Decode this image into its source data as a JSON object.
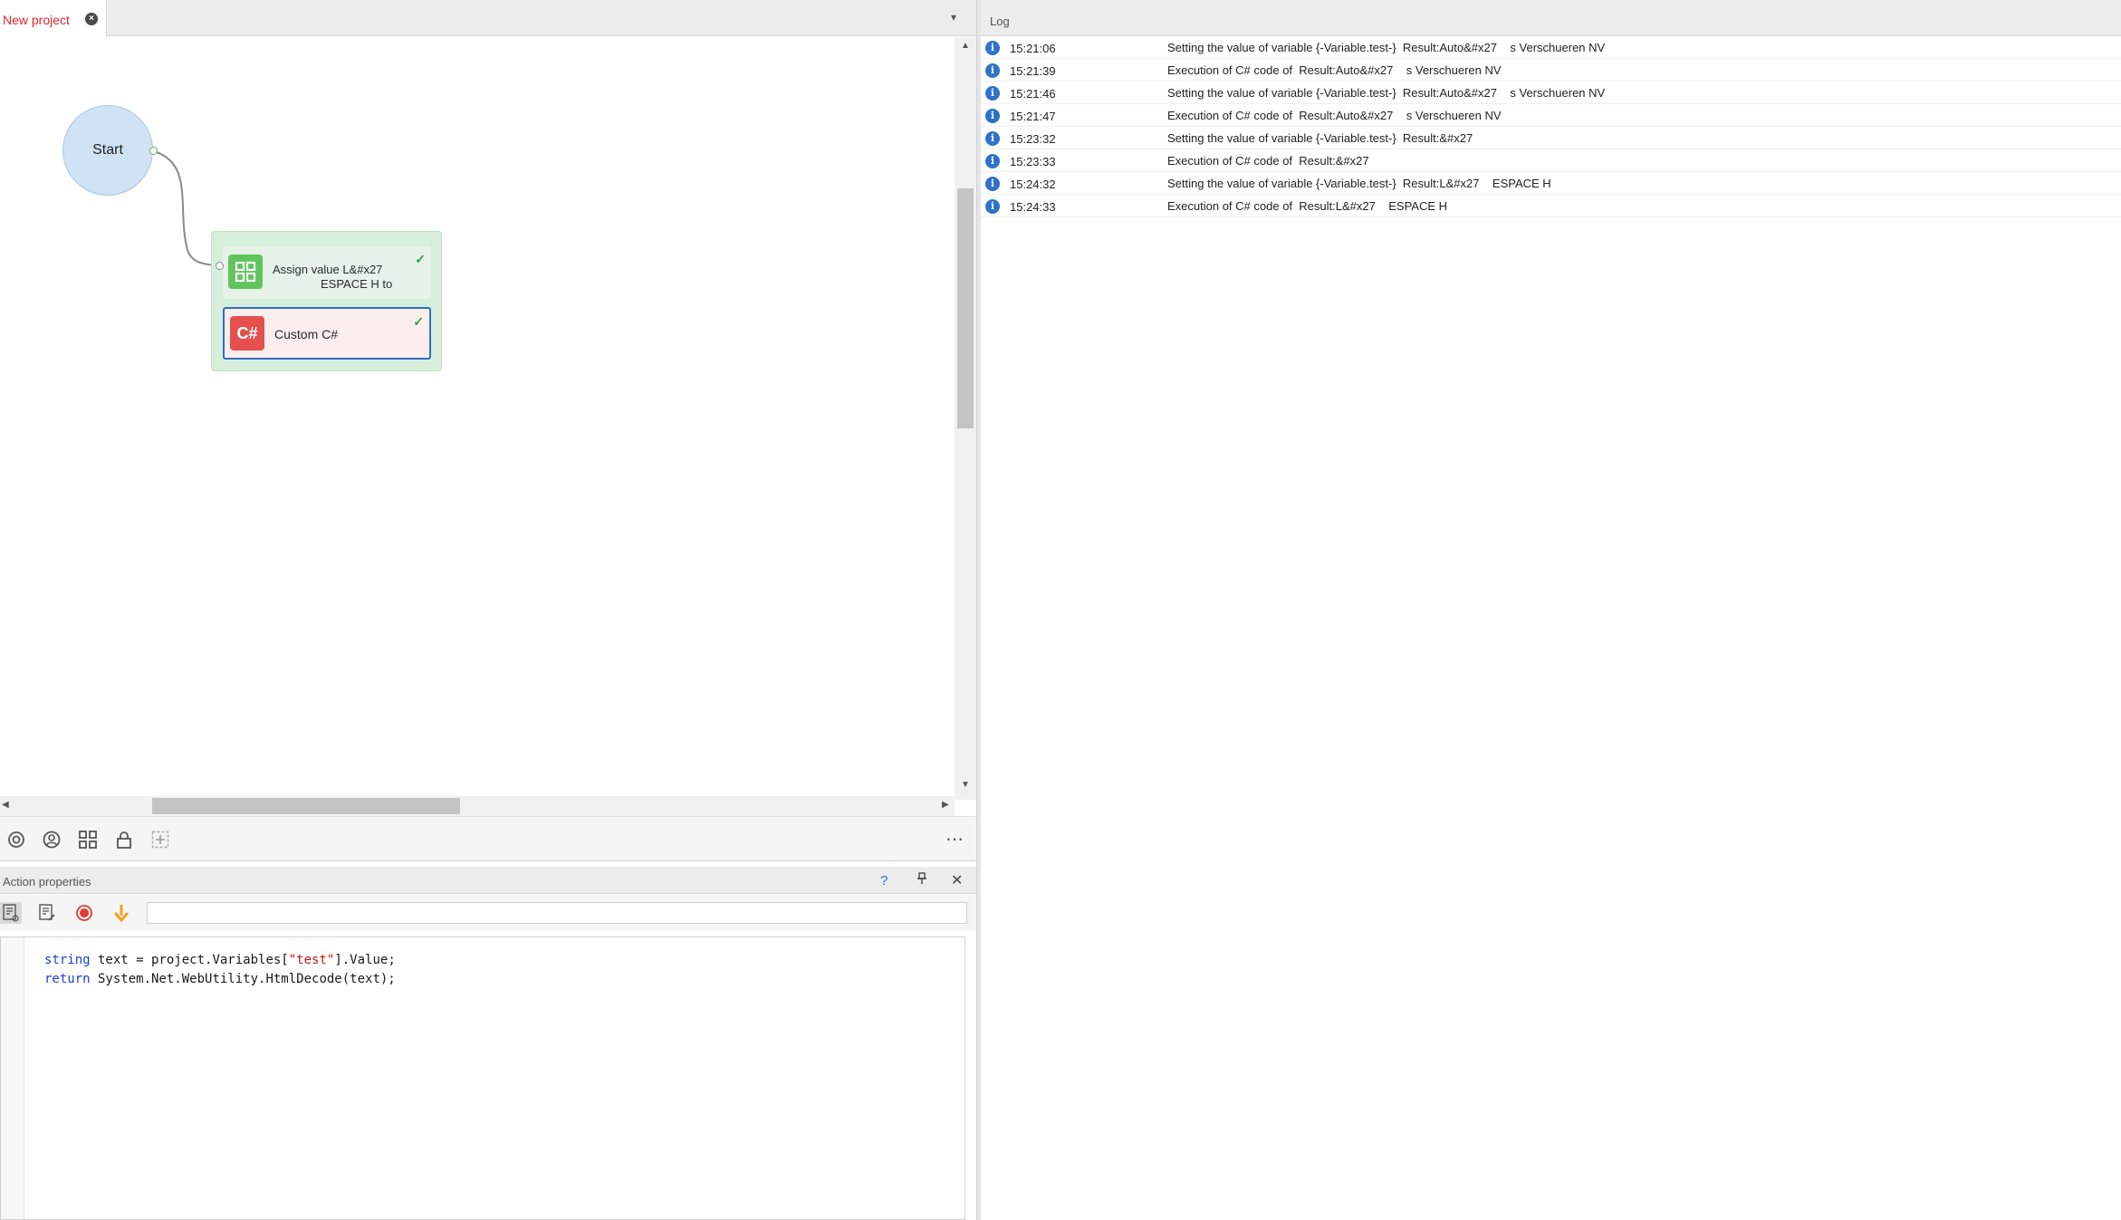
{
  "project_tab": {
    "label": "New project",
    "close_glyph": "×"
  },
  "canvas": {
    "start_node_label": "Start",
    "assign_action": {
      "line1": "Assign value L&#x27",
      "line2": "ESPACE H to",
      "icon": "grid-icon"
    },
    "csharp_action": {
      "label": "Custom C#",
      "icon_text": "C#"
    },
    "check_glyph": "✓"
  },
  "canvas_toolbar": {
    "icons": [
      "settings-icon",
      "user-circle-icon",
      "grid-icon",
      "lock-icon",
      "add-frame-icon"
    ],
    "more_glyph": "⋯"
  },
  "action_properties": {
    "title": "Action properties",
    "help_glyph": "?",
    "pin_glyph": "🖈",
    "close_glyph": "✕",
    "input_value": "",
    "code_lines": [
      {
        "kw": "string",
        "rest_before": " text = project.Variables[",
        "str": "\"test\"",
        "rest_after": "].Value;"
      },
      {
        "kw": "return",
        "rest_before": " System.Net.WebUtility.HtmlDecode(text);",
        "str": "",
        "rest_after": ""
      }
    ]
  },
  "log": {
    "title": "Log",
    "info_glyph": "i",
    "entries": [
      {
        "time": "15:21:06",
        "message": "Setting the value of variable {-Variable.test-}  Result:Auto&#x27    s Verschueren NV"
      },
      {
        "time": "15:21:39",
        "message": "Execution of C# code of  Result:Auto&#x27    s Verschueren NV"
      },
      {
        "time": "15:21:46",
        "message": "Setting the value of variable {-Variable.test-}  Result:Auto&#x27    s Verschueren NV"
      },
      {
        "time": "15:21:47",
        "message": "Execution of C# code of  Result:Auto&#x27    s Verschueren NV"
      },
      {
        "time": "15:23:32",
        "message": "Setting the value of variable {-Variable.test-}  Result:&#x27"
      },
      {
        "time": "15:23:33",
        "message": "Execution of C# code of  Result:&#x27"
      },
      {
        "time": "15:24:32",
        "message": "Setting the value of variable {-Variable.test-}  Result:L&#x27    ESPACE H"
      },
      {
        "time": "15:24:33",
        "message": "Execution of C# code of  Result:L&#x27    ESPACE H"
      }
    ]
  },
  "colors": {
    "tab_active_text": "#e0262a",
    "start_node_fill": "#cfe3f4",
    "group_fill": "#d8eedc",
    "assign_icon_bg": "#5fc45c",
    "csharp_icon_bg": "#e4504e",
    "selection_border": "#2e6fc0",
    "log_info_icon": "#2e72c9",
    "record_button": "#e53935",
    "step_button": "#f0a020"
  }
}
